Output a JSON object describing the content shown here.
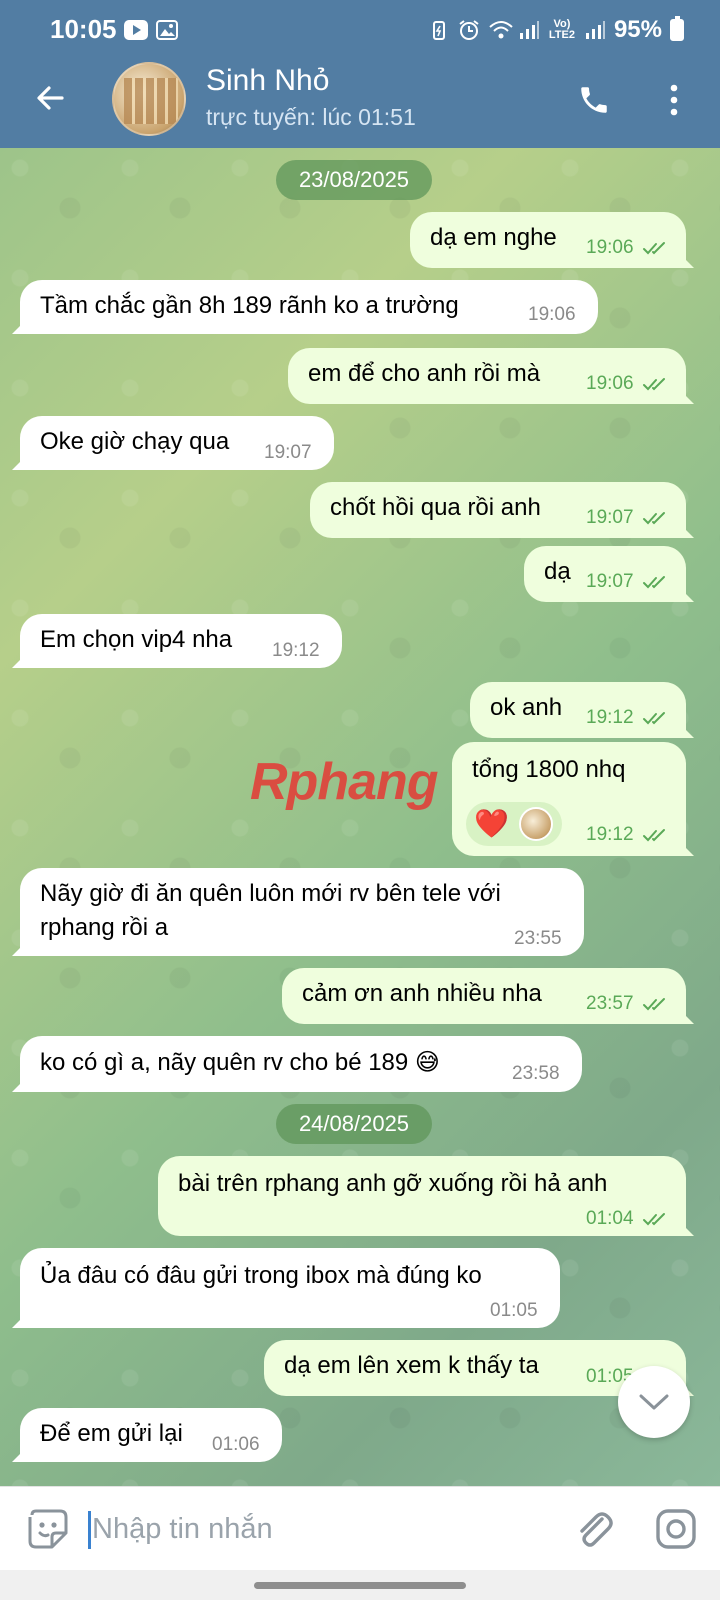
{
  "status_bar": {
    "time": "10:05",
    "network": "Vo) LTE2",
    "battery": "95%"
  },
  "header": {
    "name": "Sinh Nhỏ",
    "status": "trực tuyến: lúc 01:51",
    "background_color": "#527da3"
  },
  "chat": {
    "date_1": "23/08/2025",
    "date_2": "24/08/2025",
    "messages": [
      {
        "dir": "out",
        "text": "dạ em nghe",
        "time": "19:06"
      },
      {
        "dir": "in",
        "text": "Tầm chắc gần 8h 189 rãnh ko a trường",
        "time": "19:06"
      },
      {
        "dir": "out",
        "text": "em để cho anh rồi mà",
        "time": "19:06"
      },
      {
        "dir": "in",
        "text": "Oke giờ chạy qua",
        "time": "19:07"
      },
      {
        "dir": "out",
        "text": "chốt hồi qua rồi anh",
        "time": "19:07"
      },
      {
        "dir": "out",
        "text": "dạ",
        "time": "19:07"
      },
      {
        "dir": "in",
        "text": "Em chọn vip4 nha",
        "time": "19:12"
      },
      {
        "dir": "out",
        "text": "ok anh",
        "time": "19:12"
      },
      {
        "dir": "out",
        "text": "tổng 1800 nhq",
        "time": "19:12",
        "reaction": "❤️"
      },
      {
        "dir": "in",
        "text": "Nãy giờ đi ăn quên luôn mới rv bên tele với",
        "text2": "rphang rồi a",
        "time": "23:55"
      },
      {
        "dir": "out",
        "text": "cảm ơn anh nhiều nha",
        "time": "23:57"
      },
      {
        "dir": "in",
        "text": "ko có gì a, nãy quên rv cho bé 189 😅",
        "time": "23:58"
      },
      {
        "dir": "out",
        "text": "bài trên rphang anh gỡ xuống rồi hả anh",
        "time": "01:04"
      },
      {
        "dir": "in",
        "text": "Ủa đâu có đâu gửi trong ibox mà đúng ko",
        "time": "01:05"
      },
      {
        "dir": "out",
        "text": "dạ em lên xem k thấy ta",
        "time": "01:05"
      },
      {
        "dir": "in",
        "text": "Để em gửi lại",
        "time": "01:06"
      }
    ],
    "watermark_1": "Rphang",
    "watermark_2": ""
  },
  "input": {
    "placeholder": "Nhập tin nhắn"
  },
  "colors": {
    "outgoing_bubble": "#effedd",
    "incoming_bubble": "#ffffff",
    "outgoing_time": "#5aa957",
    "date_chip": "#5f965a"
  }
}
